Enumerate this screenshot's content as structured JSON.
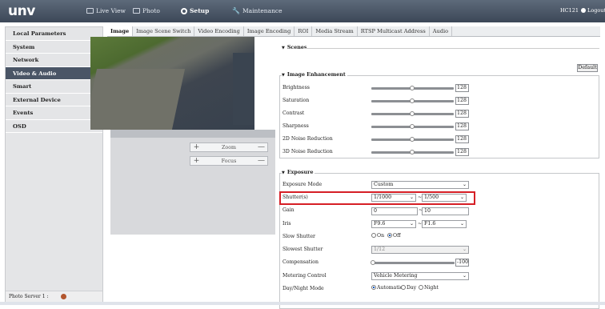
{
  "app": {
    "logo": "unv",
    "user": "HC121",
    "logout": "Logout"
  },
  "nav": [
    {
      "label": "Live View",
      "icon": "monitor-icon"
    },
    {
      "label": "Photo",
      "icon": "photo-icon"
    },
    {
      "label": "Setup",
      "icon": "gear-icon"
    },
    {
      "label": "Maintenance",
      "icon": "wrench-icon"
    }
  ],
  "sidebar": {
    "items": [
      "Local Parameters",
      "System",
      "Network",
      "Video & Audio",
      "Smart",
      "External Device",
      "Events",
      "OSD"
    ],
    "active": "Video & Audio",
    "photo_server": "Photo Server 1 :"
  },
  "tabs": [
    "Image",
    "Image Scene Switch",
    "Video Encoding",
    "Image Encoding",
    "ROI",
    "Media Stream",
    "RTSP Multicast Address",
    "Audio"
  ],
  "ptz": {
    "zoom": "Zoom",
    "focus": "Focus",
    "plus": "+",
    "minus": "—"
  },
  "scenes": {
    "title": "Scenes",
    "default_btn": "Default"
  },
  "enhancement": {
    "title": "Image Enhancement",
    "rows": [
      {
        "label": "Brightness",
        "value": "128"
      },
      {
        "label": "Saturation",
        "value": "128"
      },
      {
        "label": "Contrast",
        "value": "128"
      },
      {
        "label": "Sharpness",
        "value": "128"
      },
      {
        "label": "2D Noise Reduction",
        "value": "128"
      },
      {
        "label": "3D Noise Reduction",
        "value": "128"
      }
    ]
  },
  "exposure": {
    "title": "Exposure",
    "mode_label": "Exposure Mode",
    "mode_value": "Custom",
    "shutter_label": "Shutter(s)",
    "shutter_min": "1/1000",
    "shutter_max": "1/500",
    "gain_label": "Gain",
    "gain_min": "0",
    "gain_max": "10",
    "iris_label": "Iris",
    "iris_min": "F9.6",
    "iris_max": "F1.6",
    "slow_shutter_label": "Slow Shutter",
    "on": "On",
    "off": "Off",
    "slowest_label": "Slowest Shutter",
    "slowest_value": "1/12",
    "comp_label": "Compensation",
    "comp_value": "-100",
    "metering_label": "Metering Control",
    "metering_value": "Vehicle Metering",
    "daynight_label": "Day/Night Mode",
    "automatic": "Automatic",
    "day": "Day",
    "night": "Night",
    "dash": "~"
  }
}
